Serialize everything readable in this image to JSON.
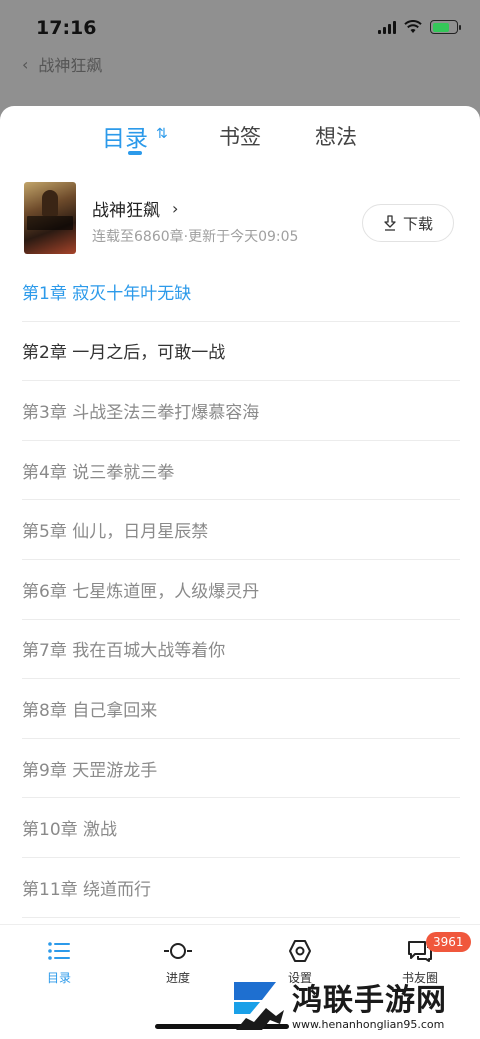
{
  "status_bar": {
    "time": "17:16"
  },
  "background_nav": {
    "back_icon": "chevron-left-icon",
    "title": "战神狂飙"
  },
  "tabs": [
    {
      "label": "目录",
      "active": true
    },
    {
      "label": "书签",
      "active": false
    },
    {
      "label": "想法",
      "active": false
    }
  ],
  "sort_icon_label": "⇅",
  "book": {
    "title": "战神狂飙",
    "meta": "连载至6860章·更新于今天09:05",
    "download_label": "下载"
  },
  "chapters": [
    "第1章  寂灭十年叶无缺",
    "第2章  一月之后，可敢一战",
    "第3章  斗战圣法三拳打爆慕容海",
    "第4章  说三拳就三拳",
    "第5章  仙儿，日月星辰禁",
    "第6章  七星炼道匣，人级爆灵丹",
    "第7章  我在百城大战等着你",
    "第8章  自己拿回来",
    "第9章  天罡游龙手",
    "第10章  激战",
    "第11章  绕道而行"
  ],
  "bottom_bar": {
    "items": [
      {
        "label": "目录",
        "icon": "list-icon"
      },
      {
        "label": "进度",
        "icon": "progress-icon"
      },
      {
        "label": "设置",
        "icon": "settings-icon"
      },
      {
        "label": "书友圈",
        "icon": "chat-icon"
      }
    ],
    "badge": "3961"
  },
  "watermark": {
    "name": "鸿联手游网",
    "url": "www.henanhonglian95.com"
  },
  "colors": {
    "accent": "#2c9aea",
    "badge": "#f0573c"
  }
}
